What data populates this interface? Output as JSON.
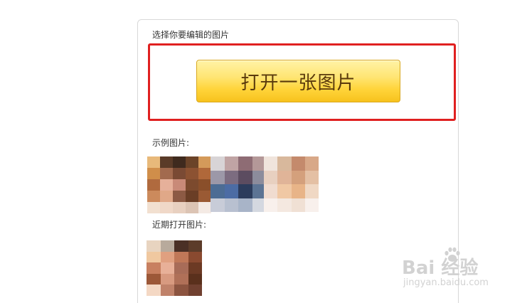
{
  "dialog": {
    "choose_label": "选择你要编辑的图片",
    "open_button_label": "打开一张图片",
    "samples_label": "示例图片:",
    "recent_label": "近期打开图片:"
  },
  "highlight_color": "#e02020",
  "button_colors": {
    "top": "#fff3a6",
    "bottom": "#f7c21d",
    "text": "#5a3a0c",
    "border": "#d9a81e"
  },
  "sample_thumbnails": [
    {
      "name": "sample-image-1",
      "pixels": [
        "#e8b97a",
        "#5a3b28",
        "#3f2a1e",
        "#6b4328",
        "#d49a5a",
        "#d08e4a",
        "#a26a4e",
        "#7a4a34",
        "#8c5232",
        "#b0683a",
        "#b06a3e",
        "#e6b09a",
        "#c98a78",
        "#7c4a2e",
        "#8a4f2a",
        "#cc8a5c",
        "#e0a888",
        "#8c5a44",
        "#6a3e26",
        "#9a5a34",
        "#f2e0d0",
        "#f0d8c8",
        "#e8d0c0",
        "#dcc4b4",
        "#f4eae4"
      ]
    },
    {
      "name": "sample-image-2",
      "pixels": [
        "#d8d4d6",
        "#c0a4a4",
        "#8e6c74",
        "#b49898",
        "#9c98a8",
        "#7c6c80",
        "#5c4c60",
        "#8c8c9c",
        "#4c6c94",
        "#4c6ca4",
        "#2c3c5c",
        "#5c7494",
        "#c8ccd8",
        "#b8c0d0",
        "#a8b4c8",
        "#d4d8e0"
      ]
    },
    {
      "name": "sample-image-3",
      "pixels": [
        "#f0e4dc",
        "#d8b89c",
        "#c48a6c",
        "#d8a888",
        "#e8d0c0",
        "#e0b498",
        "#d4a07c",
        "#e4c0a4",
        "#f0dcd0",
        "#f0c8a4",
        "#e8b488",
        "#f0d8c4",
        "#f8f0ec",
        "#f4e8e0",
        "#f0e0d4",
        "#f8f0ec"
      ]
    }
  ],
  "recent_thumbnails": [
    {
      "name": "recent-image-1",
      "pixels": [
        "#e8d4c0",
        "#b8aa9c",
        "#4a3026",
        "#5c3c2a",
        "#f0c8a0",
        "#e0a080",
        "#c07858",
        "#8a4a30",
        "#c88060",
        "#e8b098",
        "#a86c58",
        "#6c3a24",
        "#9c5838",
        "#d89a80",
        "#b07058",
        "#5a301c",
        "#f4d8c4",
        "#c0826a",
        "#8c5440",
        "#704030"
      ]
    }
  ],
  "watermark": {
    "logo_text": "Bai  经验",
    "url_text": "jingyan.baidu.com"
  }
}
